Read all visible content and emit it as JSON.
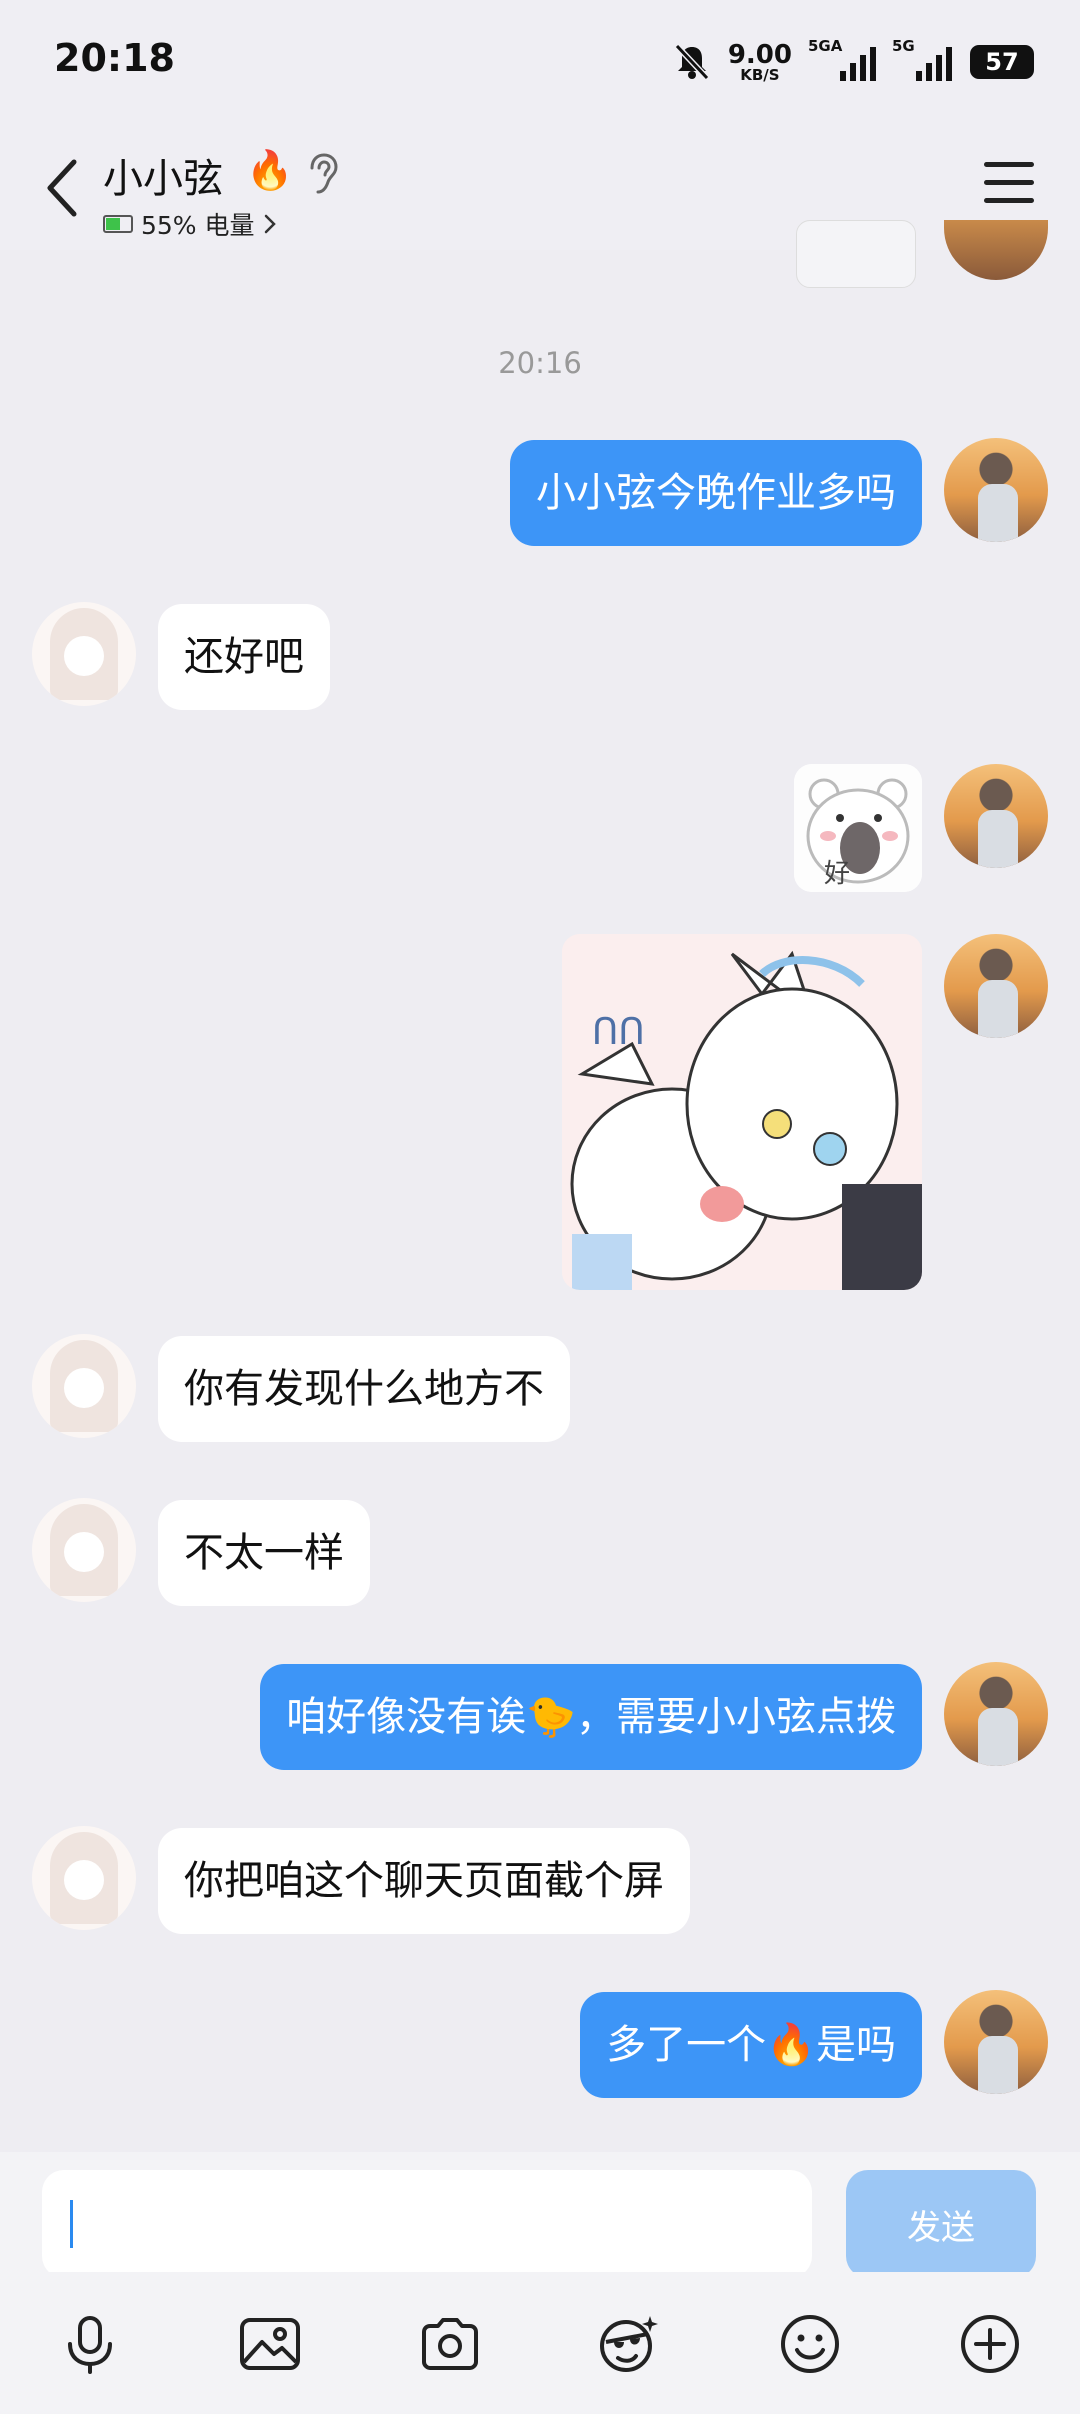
{
  "status_bar": {
    "time": "20:18",
    "net_speed_value": "9.00",
    "net_speed_unit": "KB/S",
    "sim1_label": "5GA",
    "sim2_label": "5G",
    "battery_level": "57"
  },
  "header": {
    "contact_name": "小小弦",
    "fire_badge": "🔥",
    "battery_status": "55% 电量"
  },
  "chat": {
    "timestamp": "20:16",
    "messages": [
      {
        "from": "me",
        "text": "小小弦今晚作业多吗"
      },
      {
        "from": "her",
        "text": "还好吧"
      },
      {
        "from": "me",
        "sticker": "bear-sticker"
      },
      {
        "from": "me",
        "sticker": "anime-girls-sticker"
      },
      {
        "from": "her",
        "text": "你有发现什么地方不"
      },
      {
        "from": "her",
        "text": "不太一样"
      },
      {
        "from": "me",
        "text": "咱好像没有诶🐤，需要小小弦点拨"
      },
      {
        "from": "her",
        "text": "你把咱这个聊天页面截个屏"
      },
      {
        "from": "me",
        "text": "多了一个🔥是吗"
      }
    ]
  },
  "input": {
    "value": "",
    "send_label": "发送"
  },
  "toolbar": [
    "microphone-icon",
    "image-icon",
    "camera-icon",
    "super-emoji-icon",
    "emoji-icon",
    "plus-icon"
  ]
}
